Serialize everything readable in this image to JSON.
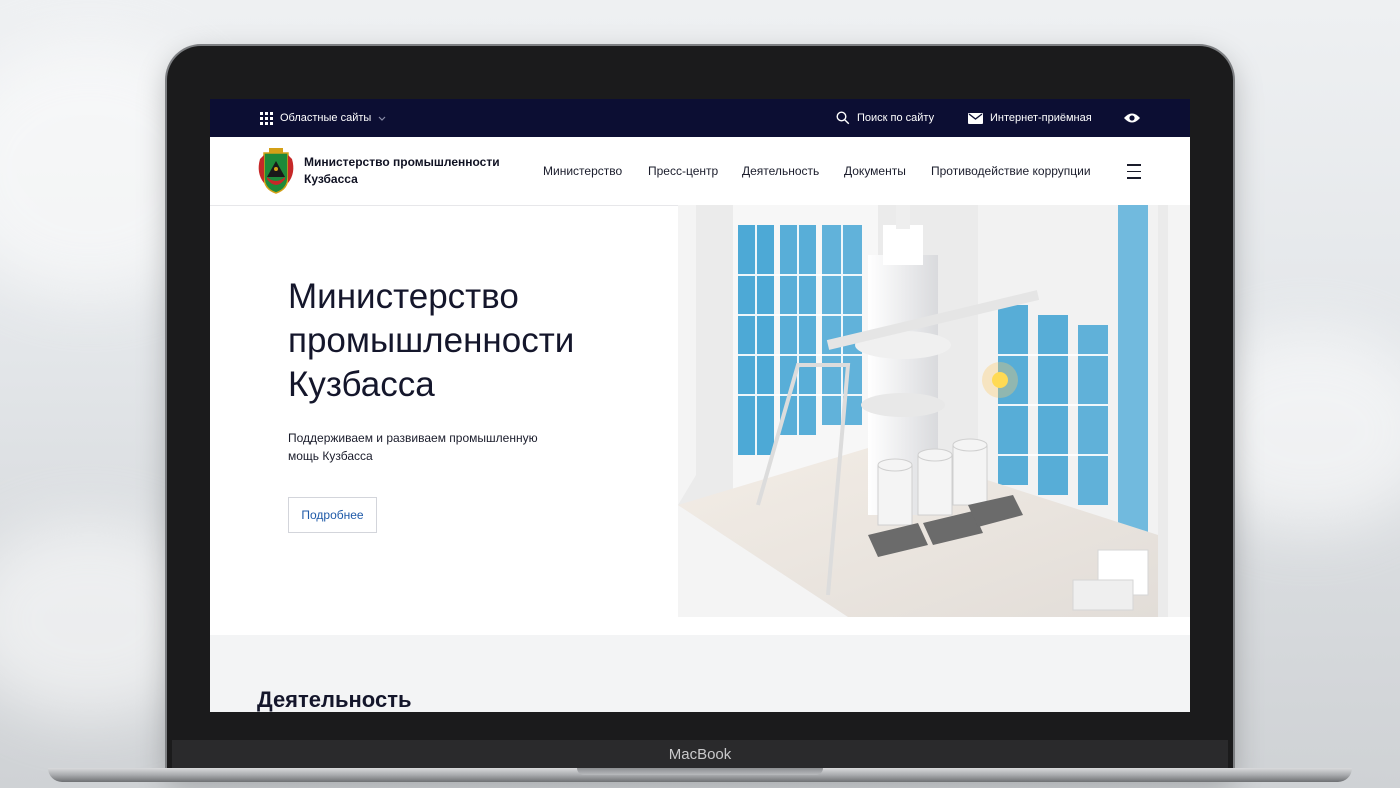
{
  "topbar": {
    "regional_sites": "Областные сайты",
    "search": "Поиск по сайту",
    "reception": "Интернет-приёмная"
  },
  "header": {
    "logo_line1": "Министерство промышленности",
    "logo_line2": "Кузбасса",
    "nav": [
      {
        "label": "Министерство"
      },
      {
        "label": "Пресс-центр"
      },
      {
        "label": "Деятельность"
      },
      {
        "label": "Документы"
      },
      {
        "label": "Противодействие коррупции"
      }
    ]
  },
  "hero": {
    "title_line1": "Министерство",
    "title_line2": "промышленности",
    "title_line3": "Кузбасса",
    "subtitle_line1": "Поддерживаем и развиваем промышленную",
    "subtitle_line2": "мощь Кузбасса",
    "cta": "Подробнее"
  },
  "section": {
    "title": "Деятельность"
  },
  "device": {
    "label": "MacBook"
  },
  "colors": {
    "topbar": "#0c0e33",
    "accent_link": "#1f5aa8",
    "panel_blue": "#2f9bd0"
  },
  "icons": {
    "grid": "grid-icon",
    "chevron": "chevron-down-icon",
    "search": "search-icon",
    "mail": "mail-icon",
    "eye": "eye-icon",
    "menu": "burger-menu-icon",
    "logo": "coat-of-arms-logo"
  }
}
